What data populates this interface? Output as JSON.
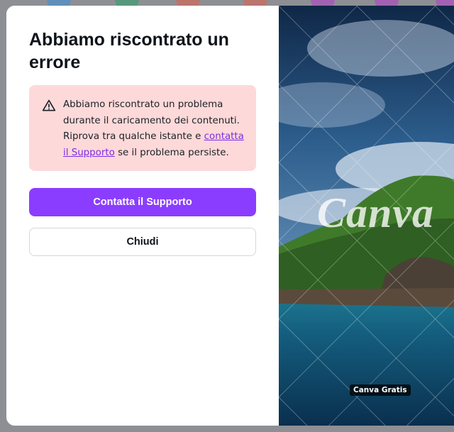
{
  "dialog": {
    "title": "Abbiamo riscontrato un errore",
    "alert": {
      "icon": "warning-icon",
      "text_before": "Abbiamo riscontrato un problema durante il caricamento dei contenuti. Riprova tra qualche istante e ",
      "link_text": "contatta il Supporto",
      "text_after": " se il problema persiste."
    },
    "primary_button": "Contatta il Supporto",
    "secondary_button": "Chiudi"
  },
  "image_panel": {
    "watermark": "Canva",
    "badge": "Canva Gratis"
  },
  "colors": {
    "accent": "#8b3dff",
    "alert_background": "#fdd9d9",
    "link": "#7d2ae8"
  }
}
